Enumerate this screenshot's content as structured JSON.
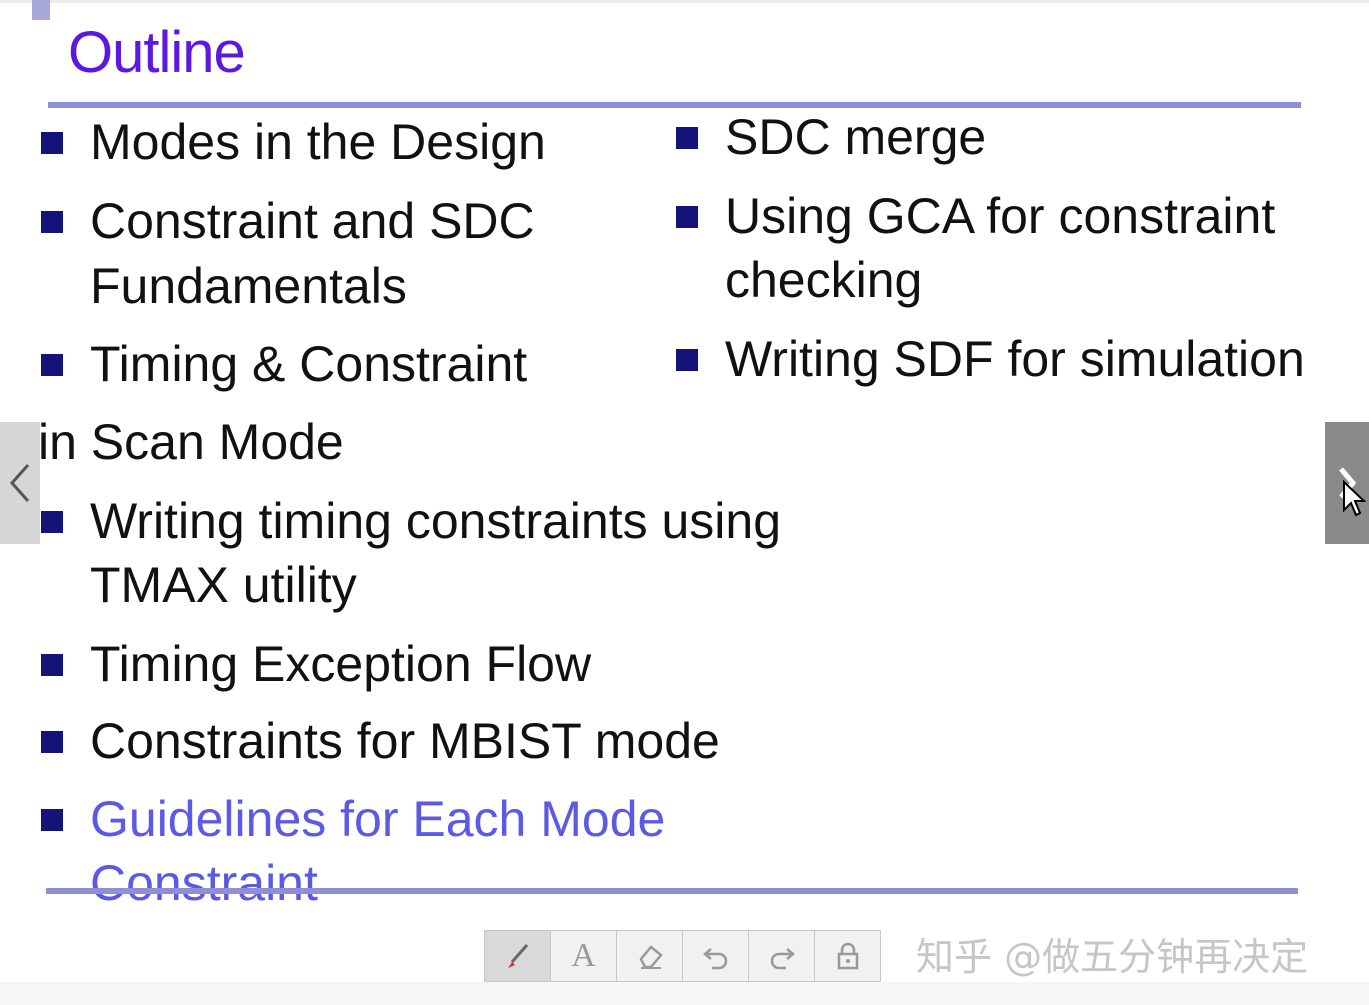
{
  "slide": {
    "title": "Outline",
    "left_items": [
      {
        "lines": [
          "Modes in the Design"
        ]
      },
      {
        "lines": [
          "Constraint and SDC",
          "Fundamentals"
        ]
      },
      {
        "lines": [
          "Timing & Constraint",
          "in Scan Mode"
        ]
      },
      {
        "lines": [
          "Writing timing constraints using",
          "TMAX utility"
        ]
      },
      {
        "lines": [
          "Timing Exception Flow"
        ]
      },
      {
        "lines": [
          "Constraints for MBIST mode"
        ]
      },
      {
        "lines": [
          "Guidelines for Each Mode",
          "Constraint"
        ]
      }
    ],
    "right_items": [
      {
        "lines": [
          "SDC merge"
        ]
      },
      {
        "lines": [
          "Using GCA for constraint",
          "checking"
        ]
      },
      {
        "lines": [
          "Writing SDF for simulation"
        ]
      }
    ],
    "colors": {
      "title": "#5a18e0",
      "rule": "#8f8fd6",
      "bullet": "#13137a",
      "highlight": "#5a5ae6"
    }
  },
  "navigation": {
    "prev_icon": "chevron-left-icon",
    "next_icon": "chevron-right-icon"
  },
  "toolbar": {
    "tools": [
      {
        "name": "pen-tool",
        "glyph": "✎"
      },
      {
        "name": "text-tool",
        "glyph": "A"
      },
      {
        "name": "eraser-tool",
        "glyph": "⌫"
      },
      {
        "name": "undo-tool",
        "glyph": "↶"
      },
      {
        "name": "redo-tool",
        "glyph": "↷"
      },
      {
        "name": "lock-tool",
        "glyph": "🔒"
      }
    ]
  },
  "watermark": "知乎 @做五分钟再决定"
}
